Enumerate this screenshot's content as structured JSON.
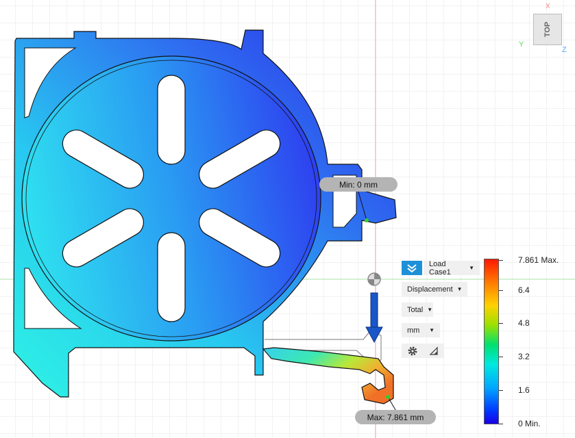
{
  "viewcube": {
    "face": "TOP",
    "axis_y": "Y",
    "axis_z": "Z",
    "axis_x": "X"
  },
  "probes": {
    "min_label": "Min: 0 mm",
    "max_label": "Max: 7.861 mm"
  },
  "controls": {
    "load_case": "Load Case1",
    "result_type": "Displacement",
    "component": "Total",
    "units": "mm"
  },
  "legend": {
    "max_label": "7.861 Max.",
    "ticks": [
      "6.4",
      "4.8",
      "3.2",
      "1.6"
    ],
    "min_label": "0 Min."
  },
  "icons": {
    "load_case_toggle": "double-chevron-icon",
    "settings": "gear-icon",
    "triangle": "triangle-icon",
    "force_arrow": "force-arrow-icon",
    "probe": "probe-target-icon"
  },
  "colors": {
    "accent": "#1e90d8",
    "force_arrow": "#1a56c8",
    "grid": "#e6e6e6"
  }
}
